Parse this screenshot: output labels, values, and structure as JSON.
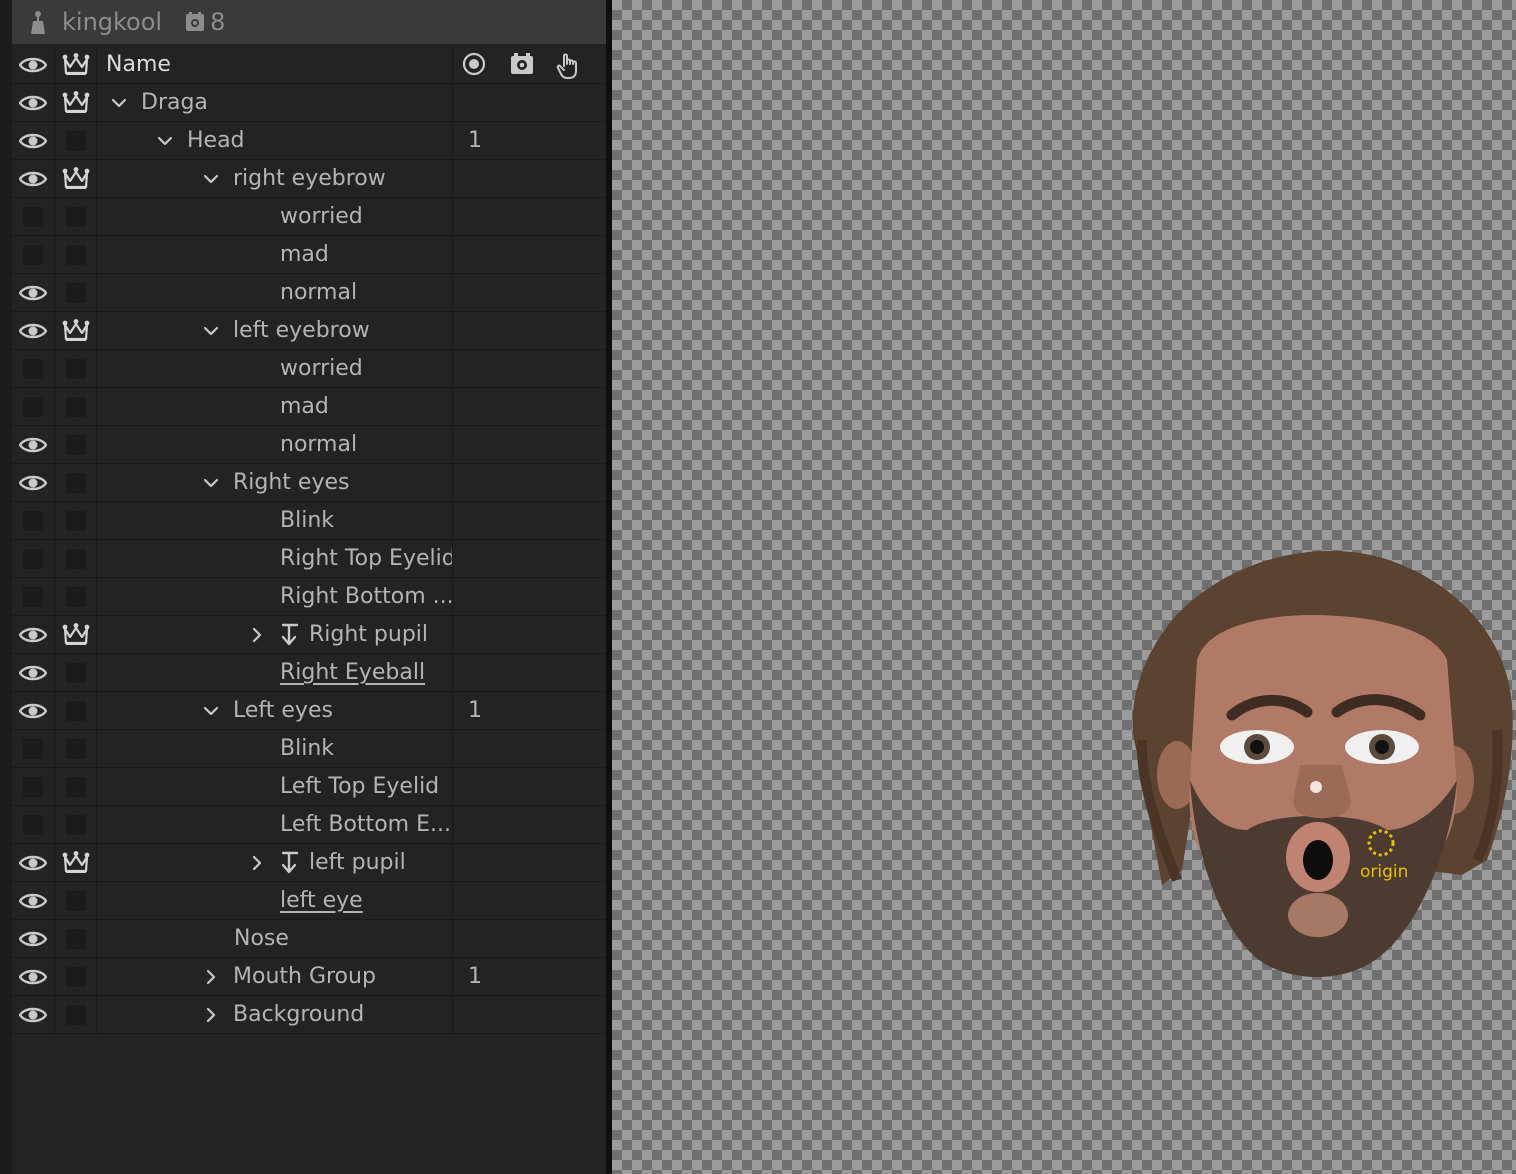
{
  "puppet": {
    "name": "kingkool",
    "behaviors_count": "8"
  },
  "columns": {
    "name": "Name"
  },
  "layers": [
    {
      "name": "Draga",
      "depth": 0,
      "expander": "open",
      "eye": true,
      "crown": true,
      "count": "",
      "link": false,
      "underline": false
    },
    {
      "name": "Head",
      "depth": 1,
      "expander": "open",
      "eye": true,
      "crown": false,
      "count": "1",
      "link": false,
      "underline": false
    },
    {
      "name": "right eyebrow",
      "depth": 2,
      "expander": "open",
      "eye": true,
      "crown": true,
      "count": "",
      "link": false,
      "underline": false
    },
    {
      "name": "worried",
      "depth": 3,
      "expander": "none",
      "eye": false,
      "crown": false,
      "count": "",
      "link": false,
      "underline": false
    },
    {
      "name": "mad",
      "depth": 3,
      "expander": "none",
      "eye": false,
      "crown": false,
      "count": "",
      "link": false,
      "underline": false
    },
    {
      "name": "normal",
      "depth": 3,
      "expander": "none",
      "eye": true,
      "crown": false,
      "count": "",
      "link": false,
      "underline": false
    },
    {
      "name": "left eyebrow",
      "depth": 2,
      "expander": "open",
      "eye": true,
      "crown": true,
      "count": "",
      "link": false,
      "underline": false
    },
    {
      "name": "worried",
      "depth": 3,
      "expander": "none",
      "eye": false,
      "crown": false,
      "count": "",
      "link": false,
      "underline": false
    },
    {
      "name": "mad",
      "depth": 3,
      "expander": "none",
      "eye": false,
      "crown": false,
      "count": "",
      "link": false,
      "underline": false
    },
    {
      "name": "normal",
      "depth": 3,
      "expander": "none",
      "eye": true,
      "crown": false,
      "count": "",
      "link": false,
      "underline": false
    },
    {
      "name": "Right eyes",
      "depth": 2,
      "expander": "open",
      "eye": true,
      "crown": false,
      "count": "",
      "link": false,
      "underline": false
    },
    {
      "name": "Blink",
      "depth": 3,
      "expander": "none",
      "eye": false,
      "crown": false,
      "count": "",
      "link": false,
      "underline": false
    },
    {
      "name": "Right Top Eyelid",
      "depth": 3,
      "expander": "none",
      "eye": false,
      "crown": false,
      "count": "",
      "link": false,
      "underline": false
    },
    {
      "name": "Right Bottom ...",
      "depth": 3,
      "expander": "none",
      "eye": false,
      "crown": false,
      "count": "",
      "link": false,
      "underline": false
    },
    {
      "name": "Right pupil",
      "depth": 3,
      "expander": "closed",
      "eye": true,
      "crown": true,
      "count": "",
      "link": true,
      "underline": false
    },
    {
      "name": "Right Eyeball",
      "depth": 3,
      "expander": "none",
      "eye": true,
      "crown": false,
      "count": "",
      "link": false,
      "underline": true
    },
    {
      "name": "Left eyes",
      "depth": 2,
      "expander": "open",
      "eye": true,
      "crown": false,
      "count": "1",
      "link": false,
      "underline": false
    },
    {
      "name": "Blink",
      "depth": 3,
      "expander": "none",
      "eye": false,
      "crown": false,
      "count": "",
      "link": false,
      "underline": false
    },
    {
      "name": "Left Top Eyelid",
      "depth": 3,
      "expander": "none",
      "eye": false,
      "crown": false,
      "count": "",
      "link": false,
      "underline": false
    },
    {
      "name": "Left Bottom E...",
      "depth": 3,
      "expander": "none",
      "eye": false,
      "crown": false,
      "count": "",
      "link": false,
      "underline": false
    },
    {
      "name": "left pupil",
      "depth": 3,
      "expander": "closed",
      "eye": true,
      "crown": true,
      "count": "",
      "link": true,
      "underline": false
    },
    {
      "name": "left eye",
      "depth": 3,
      "expander": "none",
      "eye": true,
      "crown": false,
      "count": "",
      "link": false,
      "underline": true
    },
    {
      "name": "Nose",
      "depth": 2,
      "expander": "none",
      "eye": true,
      "crown": false,
      "count": "",
      "link": false,
      "underline": false
    },
    {
      "name": "Mouth Group",
      "depth": 2,
      "expander": "closed",
      "eye": true,
      "crown": false,
      "count": "1",
      "link": false,
      "underline": false
    },
    {
      "name": "Background",
      "depth": 2,
      "expander": "closed",
      "eye": true,
      "crown": false,
      "count": "",
      "link": false,
      "underline": false
    }
  ],
  "canvas": {
    "origin_label": "origin"
  },
  "colors": {
    "panel_bg": "#232323",
    "header_bg": "#3a3a3a",
    "text": "#b4b4b4",
    "origin": "#e8c400"
  }
}
